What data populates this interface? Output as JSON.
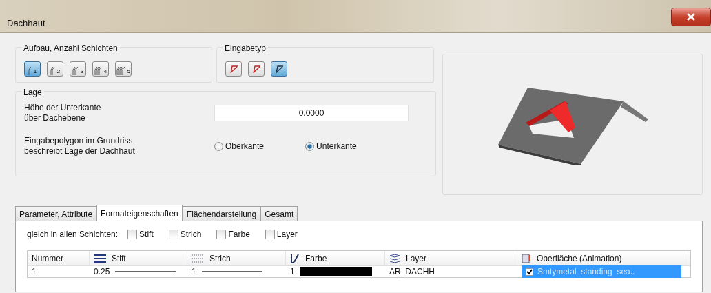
{
  "window": {
    "title": "Dachhaut"
  },
  "layers": {
    "label": "Aufbau, Anzahl Schichten",
    "buttons": [
      {
        "number": "1",
        "selected": true
      },
      {
        "number": "2",
        "selected": false
      },
      {
        "number": "3",
        "selected": false
      },
      {
        "number": "4",
        "selected": false
      },
      {
        "number": "5",
        "selected": false
      }
    ]
  },
  "input_type": {
    "label": "Eingabetyp",
    "buttons": [
      {
        "selected": false
      },
      {
        "selected": false
      },
      {
        "selected": true
      }
    ]
  },
  "position": {
    "label": "Lage",
    "height_label": [
      "Höhe der Unterkante",
      "über Dachebene"
    ],
    "height_value": "0.0000",
    "polygon_label": [
      "Eingabepolygon im Grundriss",
      "beschreibt Lage der Dachhaut"
    ],
    "radios": [
      {
        "label": "Oberkante",
        "selected": false
      },
      {
        "label": "Unterkante",
        "selected": true
      }
    ]
  },
  "tabs": [
    {
      "label": "Parameter, Attribute",
      "selected": false
    },
    {
      "label": "Formateigenschaften",
      "selected": true
    },
    {
      "label": "Flächendarstellung",
      "selected": false
    },
    {
      "label": "Gesamt",
      "selected": false
    }
  ],
  "same_in_all": {
    "label": "gleich in allen Schichten:",
    "checkboxes": [
      {
        "label": "Stift",
        "checked": false
      },
      {
        "label": "Strich",
        "checked": false
      },
      {
        "label": "Farbe",
        "checked": false
      },
      {
        "label": "Layer",
        "checked": false
      }
    ]
  },
  "table": {
    "columns": [
      {
        "label": "Nummer",
        "kind": "plain"
      },
      {
        "label": "Stift",
        "kind": "pen"
      },
      {
        "label": "Strich",
        "kind": "line"
      },
      {
        "label": "Farbe",
        "kind": "color"
      },
      {
        "label": "Layer",
        "kind": "layer"
      },
      {
        "label": "Oberfläche (Animation)",
        "kind": "surface"
      }
    ],
    "rows": [
      {
        "number": "1",
        "pen": "0.25",
        "line": "1",
        "color_index": "1",
        "color": "#000000",
        "layer": "AR_DACHH",
        "surface": "Smtymetal_standing_sea..",
        "surface_checked": true,
        "surface_selected": true
      }
    ]
  }
}
